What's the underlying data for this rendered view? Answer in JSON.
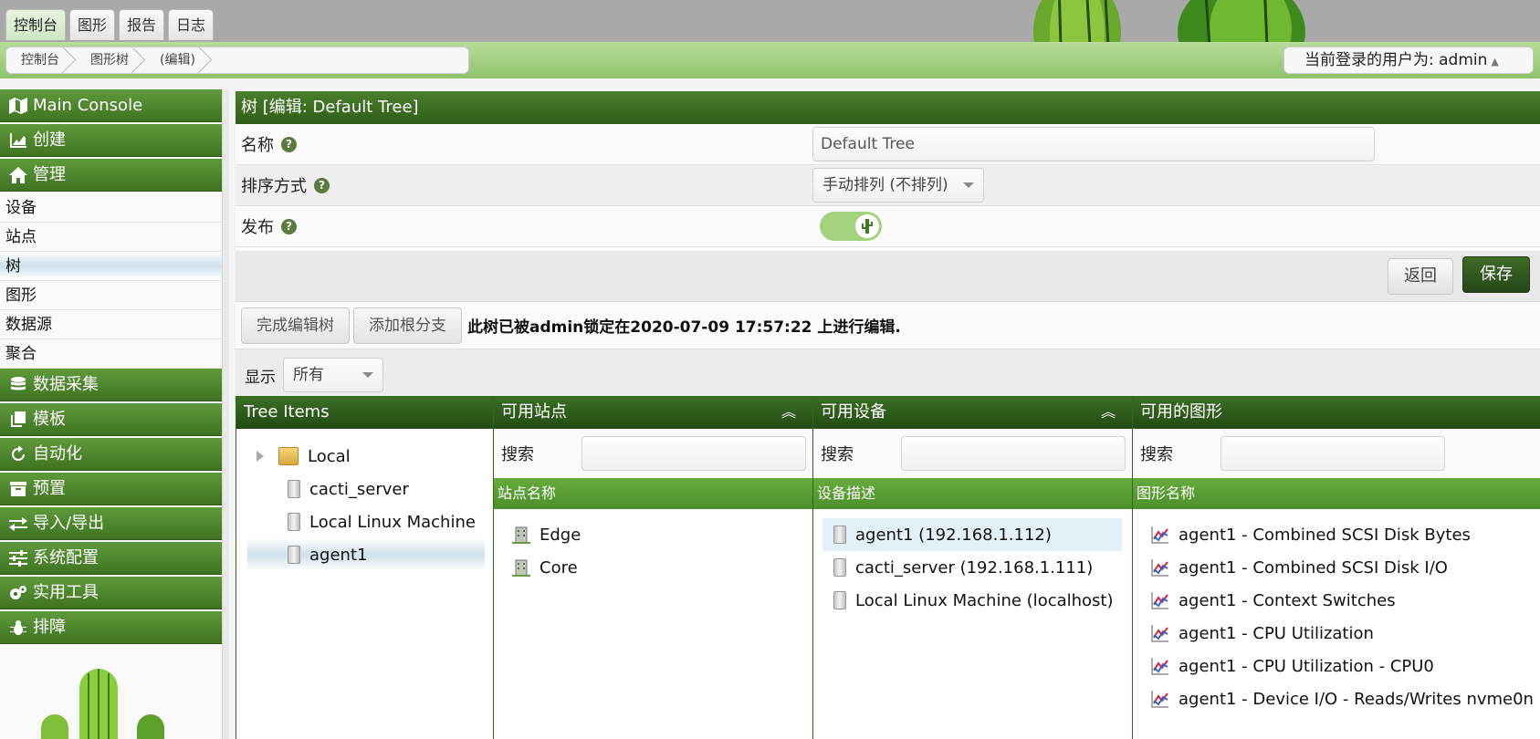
{
  "top_tabs": [
    "控制台",
    "图形",
    "报告",
    "日志"
  ],
  "breadcrumb": [
    "控制台",
    "图形树",
    "(编辑)"
  ],
  "user": {
    "label": "当前登录的用户为: admin"
  },
  "sidebar": {
    "main_console": "Main Console",
    "create": "创建",
    "manage": "管理",
    "manage_items": [
      "设备",
      "站点",
      "树",
      "图形",
      "数据源",
      "聚合"
    ],
    "sections": [
      "数据采集",
      "模板",
      "自动化",
      "预置",
      "导入/导出",
      "系统配置",
      "实用工具",
      "排障"
    ]
  },
  "tree_form": {
    "title": "树 [编辑: Default Tree]",
    "name_label": "名称",
    "name_value": "Default Tree",
    "sort_label": "排序方式",
    "sort_value": "手动排列 (不排列)",
    "publish_label": "发布",
    "back_label": "返回",
    "save_label": "保存"
  },
  "edit_bar": {
    "finish_label": "完成编辑树",
    "add_root_label": "添加根分支",
    "lock_message": "此树已被admin锁定在2020-07-09 17:57:22 上进行编辑."
  },
  "display": {
    "label": "显示",
    "value": "所有"
  },
  "panels": {
    "tree_items": {
      "title": "Tree Items",
      "items": [
        "Local",
        "cacti_server",
        "Local Linux Machine",
        "agent1"
      ]
    },
    "sites": {
      "title": "可用站点",
      "search_label": "搜索",
      "column": "站点名称",
      "items": [
        "Edge",
        "Core"
      ]
    },
    "devices": {
      "title": "可用设备",
      "search_label": "搜索",
      "column": "设备描述",
      "items": [
        "agent1 (192.168.1.112)",
        "cacti_server (192.168.1.111)",
        "Local Linux Machine (localhost)"
      ]
    },
    "graphs": {
      "title": "可用的图形",
      "search_label": "搜索",
      "column": "图形名称",
      "items": [
        "agent1 - Combined SCSI Disk Bytes",
        "agent1 - Combined SCSI Disk I/O",
        "agent1 - Context Switches",
        "agent1 - CPU Utilization",
        "agent1 - CPU Utilization - CPU0",
        "agent1 - Device I/O - Reads/Writes nvme0n"
      ]
    }
  }
}
